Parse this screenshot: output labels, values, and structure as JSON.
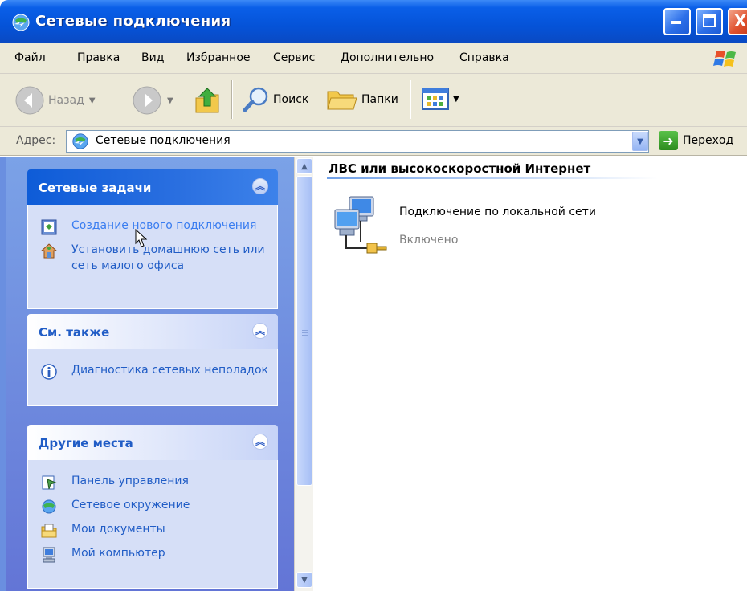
{
  "window": {
    "title": "Сетевые подключения",
    "buttons": {
      "minimize": "_",
      "maximize": "□",
      "close": "X"
    }
  },
  "menu": [
    "Файл",
    "Правка",
    "Вид",
    "Избранное",
    "Сервис",
    "Дополнительно",
    "Справка"
  ],
  "toolbar": {
    "back_label": "Назад",
    "search_label": "Поиск",
    "folders_label": "Папки"
  },
  "address": {
    "label": "Адрес:",
    "value": "Сетевые подключения",
    "go_label": "Переход"
  },
  "panels": {
    "network_tasks": {
      "title": "Сетевые задачи",
      "items": [
        {
          "label": "Создание нового подключения",
          "icon": "new-connection-icon"
        },
        {
          "label": "Установить домашнюю сеть или сеть малого офиса",
          "icon": "home-network-icon"
        }
      ]
    },
    "see_also": {
      "title": "См. также",
      "items": [
        {
          "label": "Диагностика сетевых неполадок",
          "icon": "info-icon"
        }
      ]
    },
    "other_places": {
      "title": "Другие места",
      "items": [
        {
          "label": "Панель управления",
          "icon": "control-panel-icon"
        },
        {
          "label": "Сетевое окружение",
          "icon": "network-places-icon"
        },
        {
          "label": "Мои документы",
          "icon": "my-documents-icon"
        },
        {
          "label": "Мой компьютер",
          "icon": "my-computer-icon"
        }
      ]
    }
  },
  "content": {
    "group_header": "ЛВС или высокоскоростной Интернет",
    "connection": {
      "name": "Подключение по локальной сети",
      "status": "Включено"
    }
  },
  "colors": {
    "titlebar": "#0553d8",
    "chrome": "#ece9d8",
    "taskpane": "#7ba2e7",
    "link": "#215dc6"
  }
}
